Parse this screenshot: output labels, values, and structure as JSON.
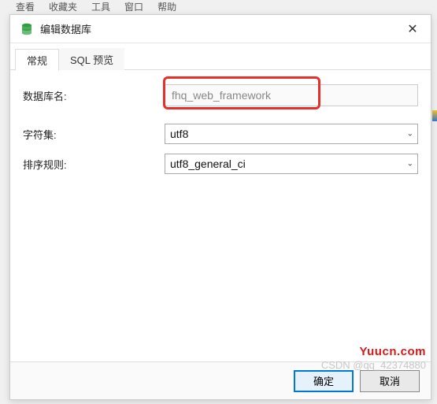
{
  "bg_menu": {
    "m0": "查看",
    "m1": "收藏夹",
    "m2": "工具",
    "m3": "窗口",
    "m4": "帮助"
  },
  "dialog": {
    "title": "编辑数据库",
    "close_glyph": "✕"
  },
  "tabs": {
    "t0": "常规",
    "t1": "SQL 预览"
  },
  "fields": {
    "db_name_label": "数据库名:",
    "db_name_value": "fhq_web_framework",
    "charset_label": "字符集:",
    "charset_value": "utf8",
    "collation_label": "排序规则:",
    "collation_value": "utf8_general_ci"
  },
  "buttons": {
    "ok": "确定",
    "cancel": "取消"
  },
  "watermark": {
    "w1": "Yuucn.com",
    "w2": "CSDN @qq_42374880"
  },
  "icons": {
    "select_arrow": "⌄"
  }
}
